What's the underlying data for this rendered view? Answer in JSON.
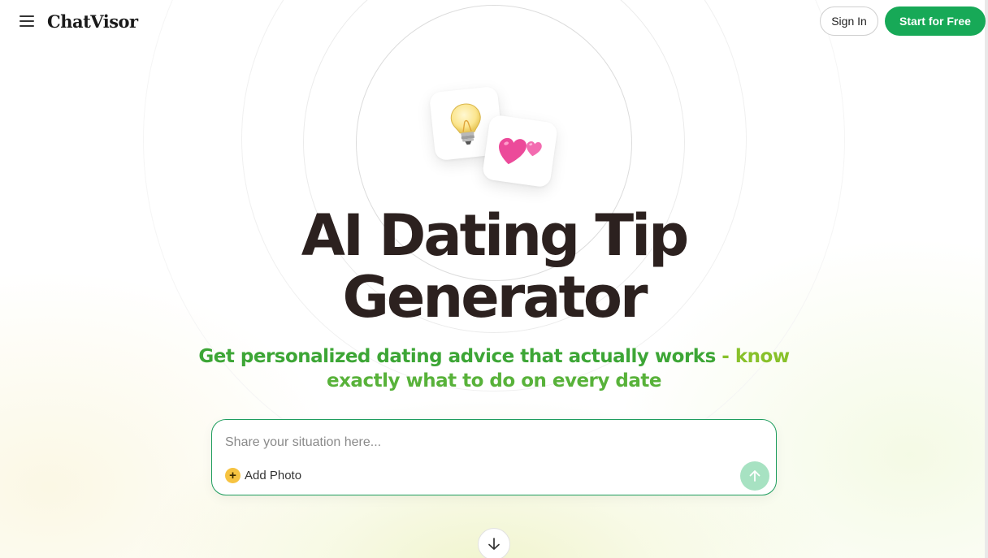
{
  "header": {
    "logo": "ChatVisor",
    "sign_in_label": "Sign In",
    "start_label": "Start for Free"
  },
  "hero": {
    "icons": [
      "lightbulb-icon",
      "two-hearts-icon"
    ],
    "title_line1": "AI Dating Tip",
    "title_line2": "Generator",
    "subtitle_line1_a": "Get personalized dating advice that actually works",
    "subtitle_line1_b": " - know",
    "subtitle_line2": "exactly what to do on every date"
  },
  "composer": {
    "placeholder": "Share your situation here...",
    "value": "",
    "add_photo_label": "Add Photo",
    "add_photo_icon": "plus-icon",
    "send_icon": "arrow-up-icon"
  },
  "scroll_icon": "arrow-down-icon",
  "colors": {
    "accent": "#17a957",
    "title": "#2c211f",
    "subtitle_green": "#3da636",
    "subtitle_lime": "#88c12a",
    "send_button": "#a7e2c2",
    "plus_badge": "#f6c341"
  }
}
